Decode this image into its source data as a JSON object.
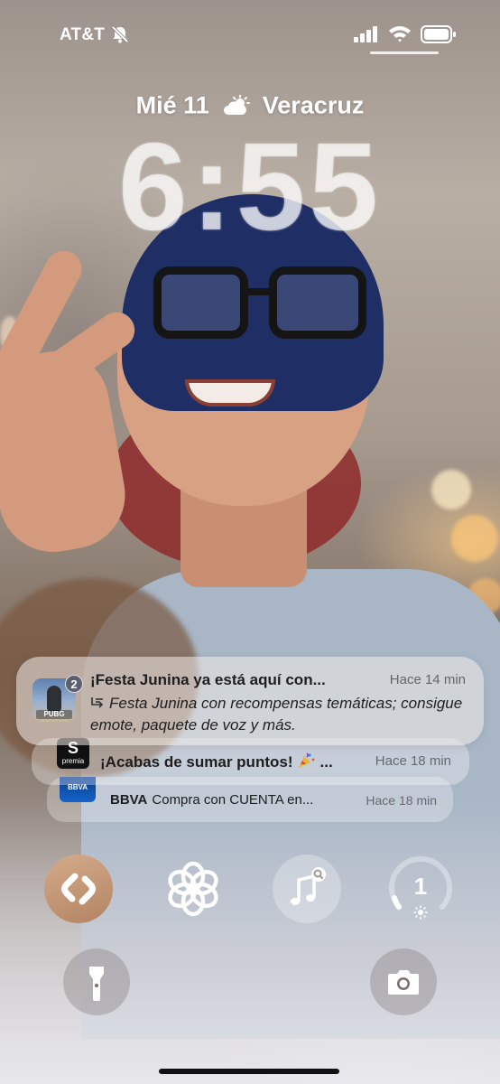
{
  "status_bar": {
    "carrier": "AT&T",
    "icons": [
      "bell-slash-icon",
      "signal-icon",
      "wifi-icon",
      "battery-icon"
    ]
  },
  "lock_screen": {
    "date": "Mié 11",
    "weather_icon": "partly-sunny-icon",
    "location": "Veracruz",
    "time": "6:55"
  },
  "notifications": [
    {
      "app_icon": "pubg-icon",
      "badge_count": "2",
      "title": "¡Festa Junina ya está aquí con...",
      "time": "Hace 14 min",
      "body": "Festa Junina con recompensas temáticas; consigue emote, paquete de voz y más."
    },
    {
      "app_icon": "premia-icon",
      "icon_text": "S",
      "icon_subtext": "premia",
      "title": "¡Acabas de sumar puntos!",
      "title_suffix": "...",
      "time": "Hace 18 min"
    },
    {
      "app_icon": "bbva-icon",
      "icon_text": "BBVA",
      "app_name": "BBVA",
      "text": "Compra con CUENTA en...",
      "time": "Hace 18 min"
    }
  ],
  "widgets": {
    "shazam": "shazam-icon",
    "chatgpt": "chatgpt-icon",
    "music": "music-search-icon",
    "brightness_value": "1"
  },
  "quick_actions": {
    "left": "flashlight-icon",
    "right": "camera-icon"
  },
  "colors": {
    "clock": "#ffffff",
    "shazam_bg": "#c99b78",
    "notification_text": "#1e1e1e"
  }
}
